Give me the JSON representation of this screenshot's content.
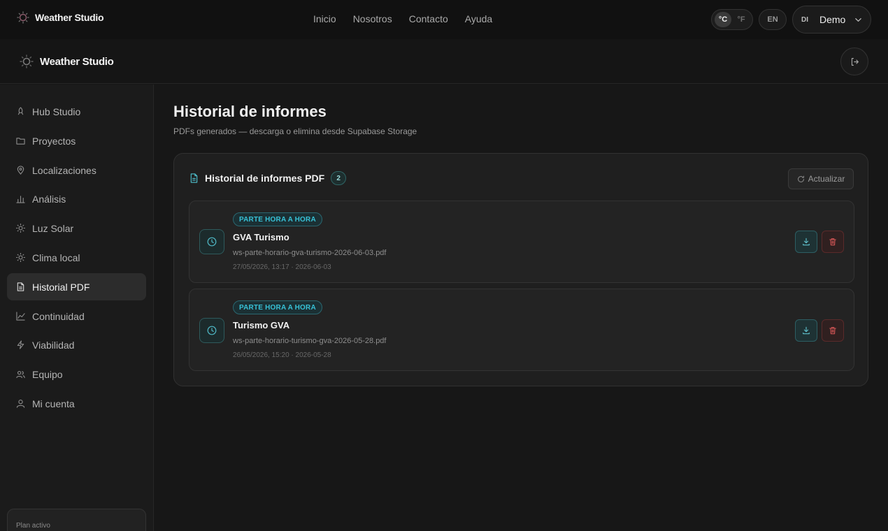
{
  "topbar": {
    "brand": "Weather Studio",
    "nav": [
      "Inicio",
      "Nosotros",
      "Contacto",
      "Ayuda"
    ],
    "units": {
      "celsius": "°C",
      "fahrenheit": "°F",
      "active": "celsius"
    },
    "language": "EN",
    "user": {
      "initials": "DI",
      "name": "Demo"
    }
  },
  "appbar": {
    "brand": "Weather Studio"
  },
  "sidebar": {
    "items": [
      {
        "label": "Hub Studio",
        "icon": "rocket-icon"
      },
      {
        "label": "Proyectos",
        "icon": "folder-icon"
      },
      {
        "label": "Localizaciones",
        "icon": "map-pin-icon"
      },
      {
        "label": "Análisis",
        "icon": "bar-chart-icon"
      },
      {
        "label": "Luz Solar",
        "icon": "sun-icon"
      },
      {
        "label": "Clima local",
        "icon": "sun-icon"
      },
      {
        "label": "Historial PDF",
        "icon": "file-text-icon",
        "active": true
      },
      {
        "label": "Continuidad",
        "icon": "line-chart-icon"
      },
      {
        "label": "Viabilidad",
        "icon": "zap-icon"
      },
      {
        "label": "Equipo",
        "icon": "users-icon"
      },
      {
        "label": "Mi cuenta",
        "icon": "user-icon"
      }
    ],
    "plan_label": "Plan activo"
  },
  "main": {
    "title": "Historial de informes",
    "subtitle": "PDFs generados — descarga o elimina desde Supabase Storage",
    "card": {
      "title": "Historial de informes PDF",
      "count": "2",
      "refresh_label": "Actualizar",
      "reports": [
        {
          "tag": "PARTE HORA A HORA",
          "name": "GVA Turismo",
          "file": "ws-parte-horario-gva-turismo-2026-06-03.pdf",
          "meta": "27/05/2026, 13:17 · 2026-06-03"
        },
        {
          "tag": "PARTE HORA A HORA",
          "name": "Turismo GVA",
          "file": "ws-parte-horario-turismo-gva-2026-05-28.pdf",
          "meta": "26/05/2026, 15:20 · 2026-05-28"
        }
      ]
    }
  },
  "colors": {
    "accent": "#37c1d6",
    "danger": "#d25555",
    "background": "#161616"
  }
}
